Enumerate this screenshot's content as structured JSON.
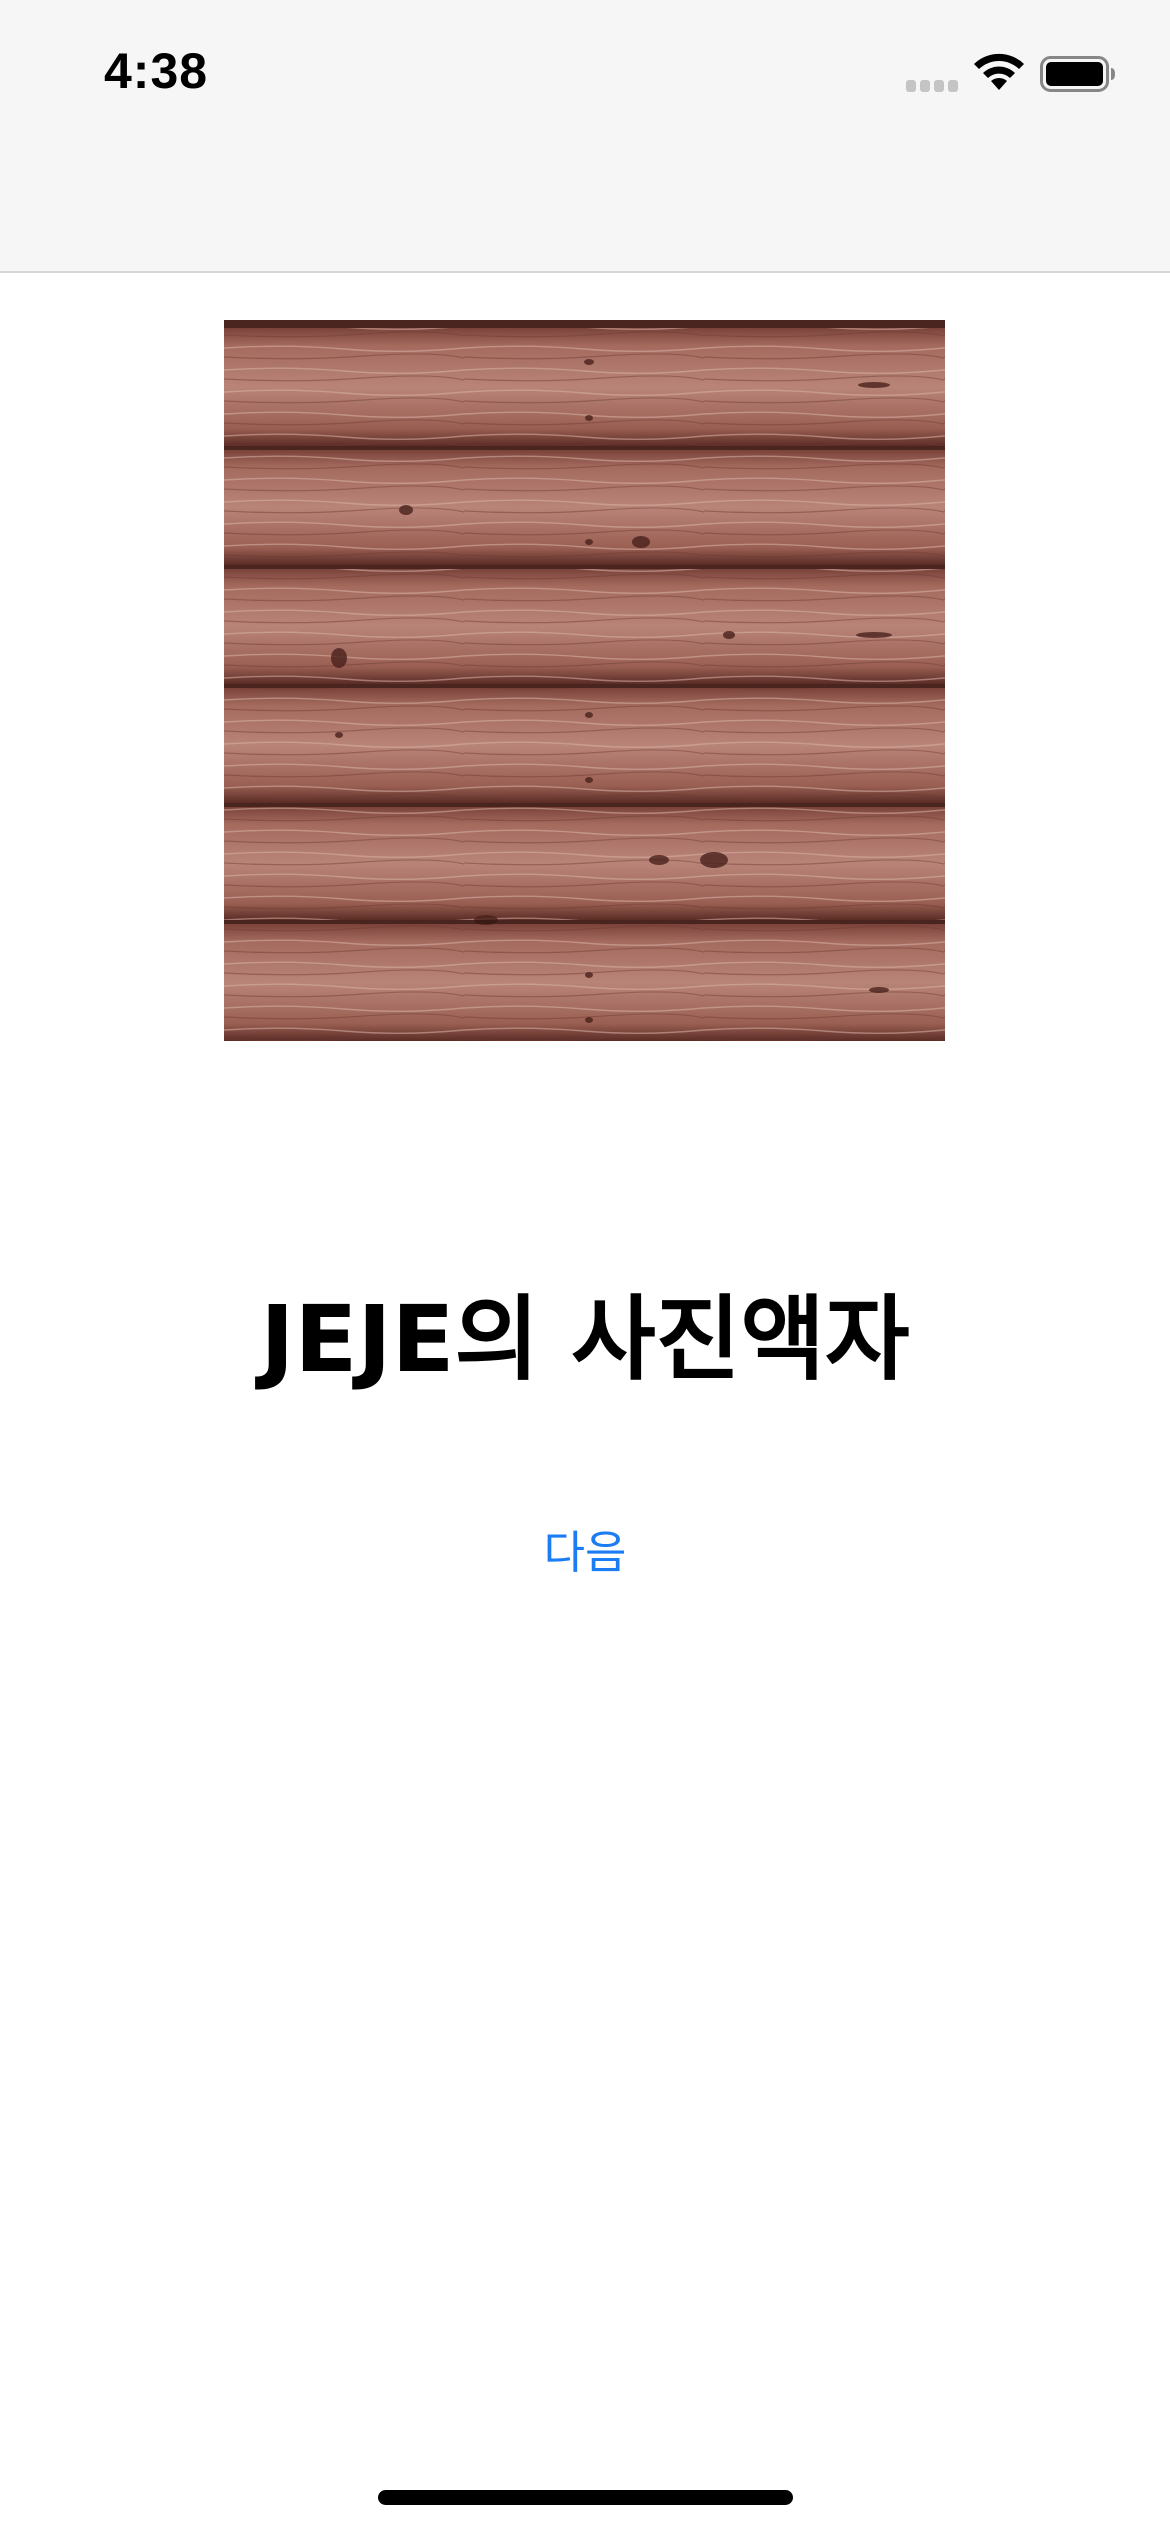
{
  "status_bar": {
    "time": "4:38",
    "signal_icon": "cellular-signal-icon",
    "wifi_icon": "wifi-icon",
    "battery_icon": "battery-icon"
  },
  "photo": {
    "icon": "wood-plank-photo",
    "description_color": "#8a4f45"
  },
  "main": {
    "title": "JEJE의 사진액자",
    "next_button_label": "다음"
  },
  "colors": {
    "accent": "#1b7cf4",
    "nav_background": "#f6f6f6"
  }
}
